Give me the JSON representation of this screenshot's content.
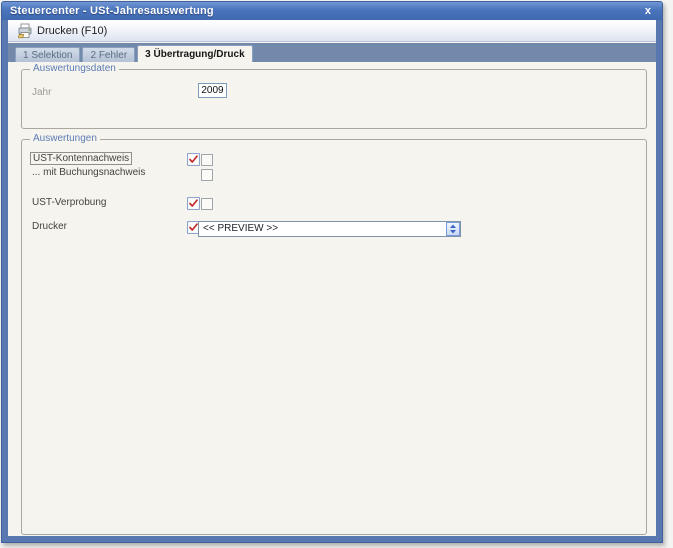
{
  "window": {
    "title": "Steuercenter - USt-Jahresauswertung",
    "close_glyph": "x"
  },
  "toolbar": {
    "print_label": "Drucken (F10)"
  },
  "tabs": [
    {
      "label": "1 Selektion",
      "active": false
    },
    {
      "label": "2 Fehler",
      "active": false
    },
    {
      "label": "3 Übertragung/Druck",
      "active": true
    }
  ],
  "groups": {
    "auswertungsdaten": {
      "legend": "Auswertungsdaten",
      "jahr_label": "Jahr",
      "jahr_value": "2009"
    },
    "auswertungen": {
      "legend": "Auswertungen",
      "rows": [
        {
          "label": "UST-Kontennachweis",
          "check_icon": true,
          "checkbox_checked": false
        },
        {
          "label": "... mit Buchungsnachweis",
          "check_icon": false,
          "checkbox_checked": false
        },
        {
          "label": "UST-Verprobung",
          "check_icon": true,
          "checkbox_checked": false
        },
        {
          "label": "Drucker",
          "check_icon": true,
          "printer_value": "<< PREVIEW >>"
        }
      ]
    }
  },
  "colors": {
    "titlebar_blue": "#4a74bb",
    "frame_blue": "#5878b0",
    "tabband_blue": "#7289ac",
    "page_cream": "#f6f4ee",
    "legend_blue": "#5b7cb5",
    "check_red": "#c42e2e"
  }
}
